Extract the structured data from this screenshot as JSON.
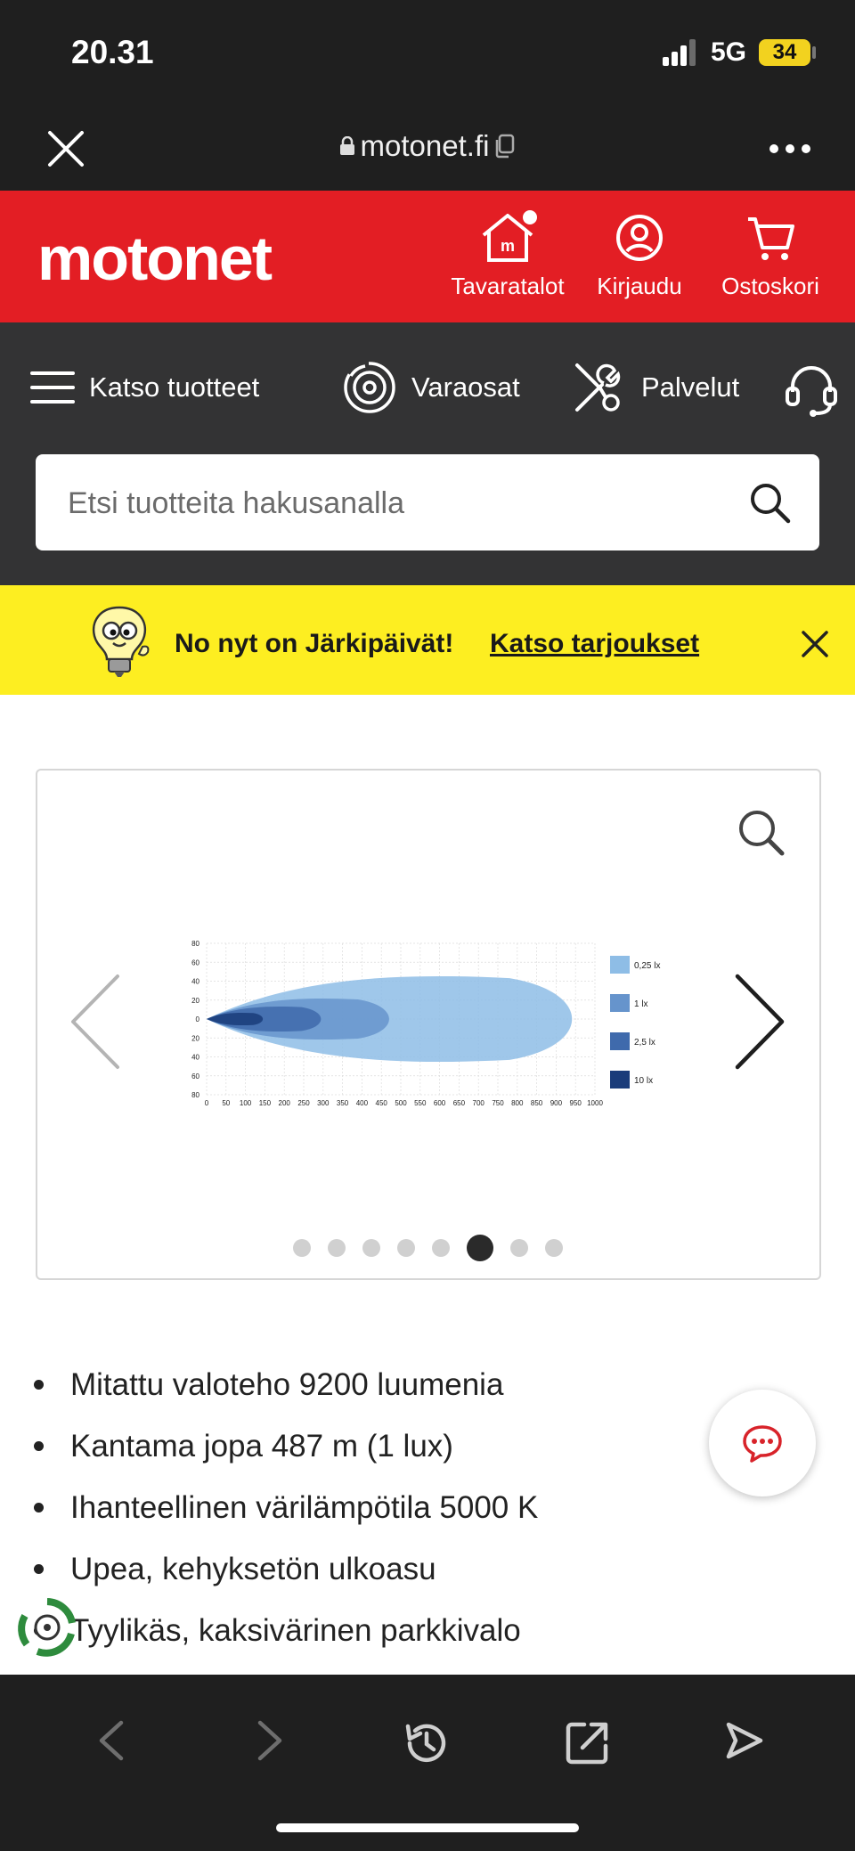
{
  "status_bar": {
    "time": "20.31",
    "network": "5G",
    "battery": "34"
  },
  "browser": {
    "url": "motonet.fi"
  },
  "header": {
    "logo": "motonet",
    "nav": [
      {
        "label": "Tavaratalot",
        "icon": "store-icon"
      },
      {
        "label": "Kirjaudu",
        "icon": "user-icon"
      },
      {
        "label": "Ostoskori",
        "icon": "cart-icon"
      }
    ]
  },
  "main_nav": {
    "items": [
      {
        "label": "Katso tuotteet",
        "icon": "menu-icon"
      },
      {
        "label": "Varaosat",
        "icon": "brake-disc-icon"
      },
      {
        "label": "Palvelut",
        "icon": "tools-icon"
      }
    ],
    "support_icon": "headset-icon"
  },
  "search": {
    "placeholder": "Etsi tuotteita hakusanalla"
  },
  "banner": {
    "text": "No nyt on Järkipäivät!",
    "link": "Katso tarjoukset"
  },
  "gallery": {
    "total_images": 8,
    "active_index": 5
  },
  "chart_data": {
    "type": "area",
    "x_ticks": [
      "0",
      "50",
      "100",
      "150",
      "200",
      "250",
      "300",
      "350",
      "400",
      "450",
      "500",
      "550",
      "600",
      "650",
      "700",
      "750",
      "800",
      "850",
      "900",
      "950",
      "1000"
    ],
    "y_ticks": [
      "80",
      "60",
      "40",
      "20",
      "0",
      "20",
      "40",
      "60",
      "80"
    ],
    "xlim": [
      0,
      1000
    ],
    "ylim": [
      -80,
      80
    ],
    "grid": true,
    "legend_position": "right",
    "series": [
      {
        "name": "0,25 lx",
        "reach": 975,
        "half_width": 48,
        "color": "#8ebde6"
      },
      {
        "name": "1 lx",
        "reach": 487,
        "half_width": 23,
        "color": "#6694cc"
      },
      {
        "name": "2,5 lx",
        "reach": 305,
        "half_width": 14,
        "color": "#3f6aac"
      },
      {
        "name": "10 lx",
        "reach": 150,
        "half_width": 7,
        "color": "#1a3c7a"
      }
    ]
  },
  "features": [
    "Mitattu valoteho 9200 luumenia",
    "Kantama jopa 487 m (1 lux)",
    "Ihanteellinen värilämpötila 5000 K",
    "Upea, kehyksetön ulkoasu",
    "Tyylikäs, kaksivärinen parkkivalo"
  ],
  "colors": {
    "brand_red": "#e31e24",
    "banner_yellow": "#fdee21",
    "nav_dark": "#333334"
  }
}
